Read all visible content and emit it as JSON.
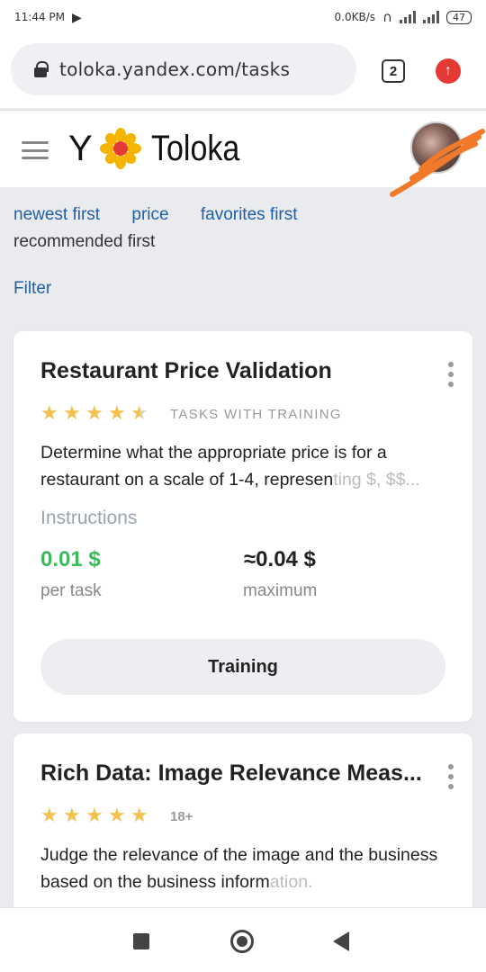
{
  "status_bar": {
    "time": "11:44 PM",
    "network_speed": "0.0KB/s",
    "battery": "47"
  },
  "browser": {
    "url": "toloka.yandex.com/tasks",
    "tab_count": "2"
  },
  "header": {
    "logo_y": "Y",
    "logo_text": "Toloka"
  },
  "sort": {
    "options": [
      "newest first",
      "price",
      "favorites first"
    ],
    "current": "recommended first"
  },
  "filter_label": "Filter",
  "tasks": [
    {
      "title": "Restaurant Price Validation",
      "tag": "TASKS WITH TRAINING",
      "rating": 4.5,
      "description": "Determine what the appropriate price is for a restaurant on a scale of 1-4, represen",
      "description_faded": "ting $, $$...",
      "instructions_label": "Instructions",
      "price": "0.01 $",
      "price_sub": "per task",
      "maximum": "≈0.04 $",
      "maximum_sub": "maximum",
      "button_label": "Training"
    },
    {
      "title": "Rich Data: Image Relevance Meas...",
      "tag": "18+",
      "rating": 5,
      "description": "Judge the relevance of the image and the business based on the business inform",
      "description_faded": "ation."
    }
  ],
  "colors": {
    "link": "#1f5fa8",
    "price_green": "#3dba5a",
    "star": "#f2c14e",
    "scribble": "#f07a2a"
  }
}
